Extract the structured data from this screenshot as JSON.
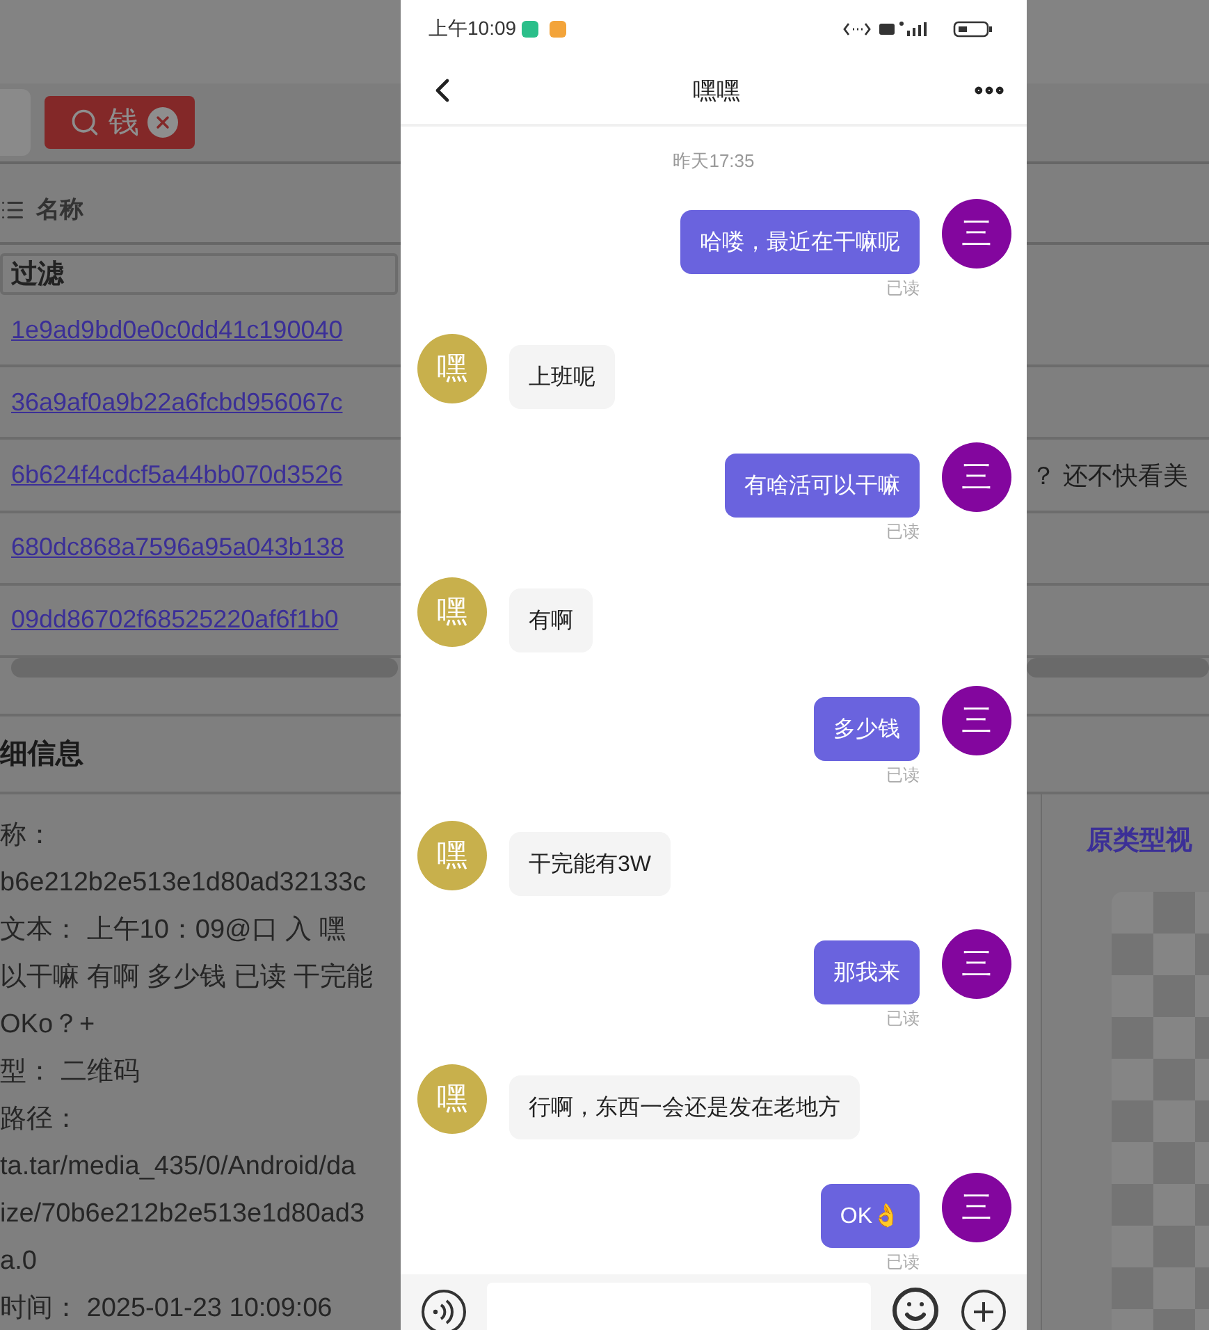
{
  "background_app": {
    "search_chip": {
      "text": "钱"
    },
    "table": {
      "column_header": "名称",
      "filter": "过滤",
      "rows": [
        {
          "name": "1e9ad9bd0e0c0dd41c190040"
        },
        {
          "name": "36a9af0a9b22a6fcbd956067c"
        },
        {
          "name": "6b624f4cdcf5a44bb070d3526",
          "column_2": "？ 还不快看美"
        },
        {
          "name": "680dc868a7596a95a043b138"
        },
        {
          "name": "09dd86702f68525220af6f1b0"
        }
      ]
    },
    "details": {
      "heading": "细信息",
      "lines": [
        {
          "label": "称："
        },
        {
          "value": "b6e212b2e513e1d80ad32133c"
        },
        {
          "label": "文本：",
          "value": "上午10：09@口 入 嘿"
        },
        {
          "value": "以干嘛 有啊 多少钱 已读 干完能"
        },
        {
          "value": "OKo？+"
        },
        {
          "label": "型：",
          "value": "二维码"
        },
        {
          "label": "路径："
        },
        {
          "value": "ta.tar/media_435/0/Android/da"
        },
        {
          "value": "ize/70b6e212b2e513e1d80ad3"
        },
        {
          "value": "a.0"
        },
        {
          "label": "时间：",
          "value": "2025-01-23 10:09:06"
        }
      ]
    },
    "preview": {
      "title": "原类型视"
    }
  },
  "phone": {
    "status_time": "上午10:09",
    "chat_title": "嘿嘿",
    "timestamp": "昨天17:35",
    "messages": [
      {
        "kind": "sent",
        "text": "哈喽，最近在干嘛呢",
        "status": "已读",
        "avatar": "三"
      },
      {
        "kind": "received",
        "text": "上班呢",
        "avatar": "嘿"
      },
      {
        "kind": "sent",
        "text": "有啥活可以干嘛",
        "status": "已读",
        "avatar": "三"
      },
      {
        "kind": "received",
        "text": "有啊",
        "avatar": "嘿"
      },
      {
        "kind": "sent",
        "text": "多少钱",
        "status": "已读",
        "avatar": "三"
      },
      {
        "kind": "received",
        "text": "干完能有3W",
        "avatar": "嘿"
      },
      {
        "kind": "sent",
        "text": "那我来",
        "status": "已读",
        "avatar": "三"
      },
      {
        "kind": "received",
        "text": "行啊，东西一会还是发在老地方",
        "avatar": "嘿"
      },
      {
        "kind": "sent",
        "text": "OK👌",
        "status": "已读",
        "avatar": "三"
      }
    ]
  }
}
